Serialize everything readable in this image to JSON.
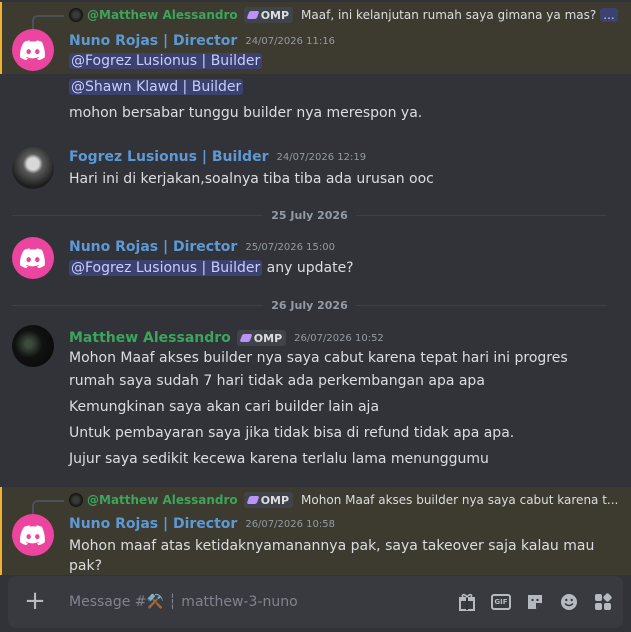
{
  "colors": {
    "background": "#313338",
    "highlight": "#3d3a2f",
    "director": "#5d99d6",
    "member": "#3ba55c",
    "mention_bg": "#3c4270"
  },
  "messages": [
    {
      "reply": {
        "name": "@Matthew Alessandro",
        "tag": "OMP",
        "text": "Maaf, ini kelanjutan rumah saya gimana ya mas?",
        "more": "..."
      },
      "author": "Nuno Rojas | Director",
      "time": "24/07/2026 11:16",
      "mention_1": "@Fogrez Lusionus | Builder",
      "mention_2": "@Shawn Klawd | Builder",
      "text": "mohon bersabar tunggu builder nya merespon ya."
    },
    {
      "author": "Fogrez Lusionus | Builder",
      "time": "24/07/2026 12:19",
      "text": "Hari ini di kerjakan,soalnya tiba tiba ada urusan ooc"
    },
    {
      "author": "Nuno Rojas | Director",
      "time": "25/07/2026 15:00",
      "mention": "@Fogrez Lusionus | Builder",
      "text": " any update?"
    },
    {
      "author": "Matthew Alessandro",
      "tag": "OMP",
      "time": "26/07/2026 10:52",
      "lines": [
        "Mohon Maaf akses builder nya saya cabut karena tepat hari ini progres",
        "rumah saya sudah 7 hari tidak ada perkembangan apa apa",
        "Kemungkinan saya akan cari builder lain aja",
        "Untuk pembayaran saya jika tidak bisa di refund tidak apa apa.",
        "Jujur saya sedikit kecewa karena terlalu lama menunggumu"
      ]
    },
    {
      "reply": {
        "name": "@Matthew Alessandro",
        "tag": "OMP",
        "text": "Mohon Maaf akses builder nya saya cabut karena t..."
      },
      "author": "Nuno Rojas | Director",
      "time": "26/07/2026 10:58",
      "lines": [
        "Mohon maaf atas ketidaknyamanannya pak, saya takeover saja kalau mau",
        "pak?"
      ]
    }
  ],
  "dividers": [
    "25 July 2026",
    "26 July 2026"
  ],
  "composer": {
    "placeholder": "Message #⚒️ ┆ matthew-3-nuno"
  },
  "icons": [
    "plus-icon",
    "gift-icon",
    "gif-icon",
    "sticker-icon",
    "emoji-icon",
    "apps-icon"
  ]
}
